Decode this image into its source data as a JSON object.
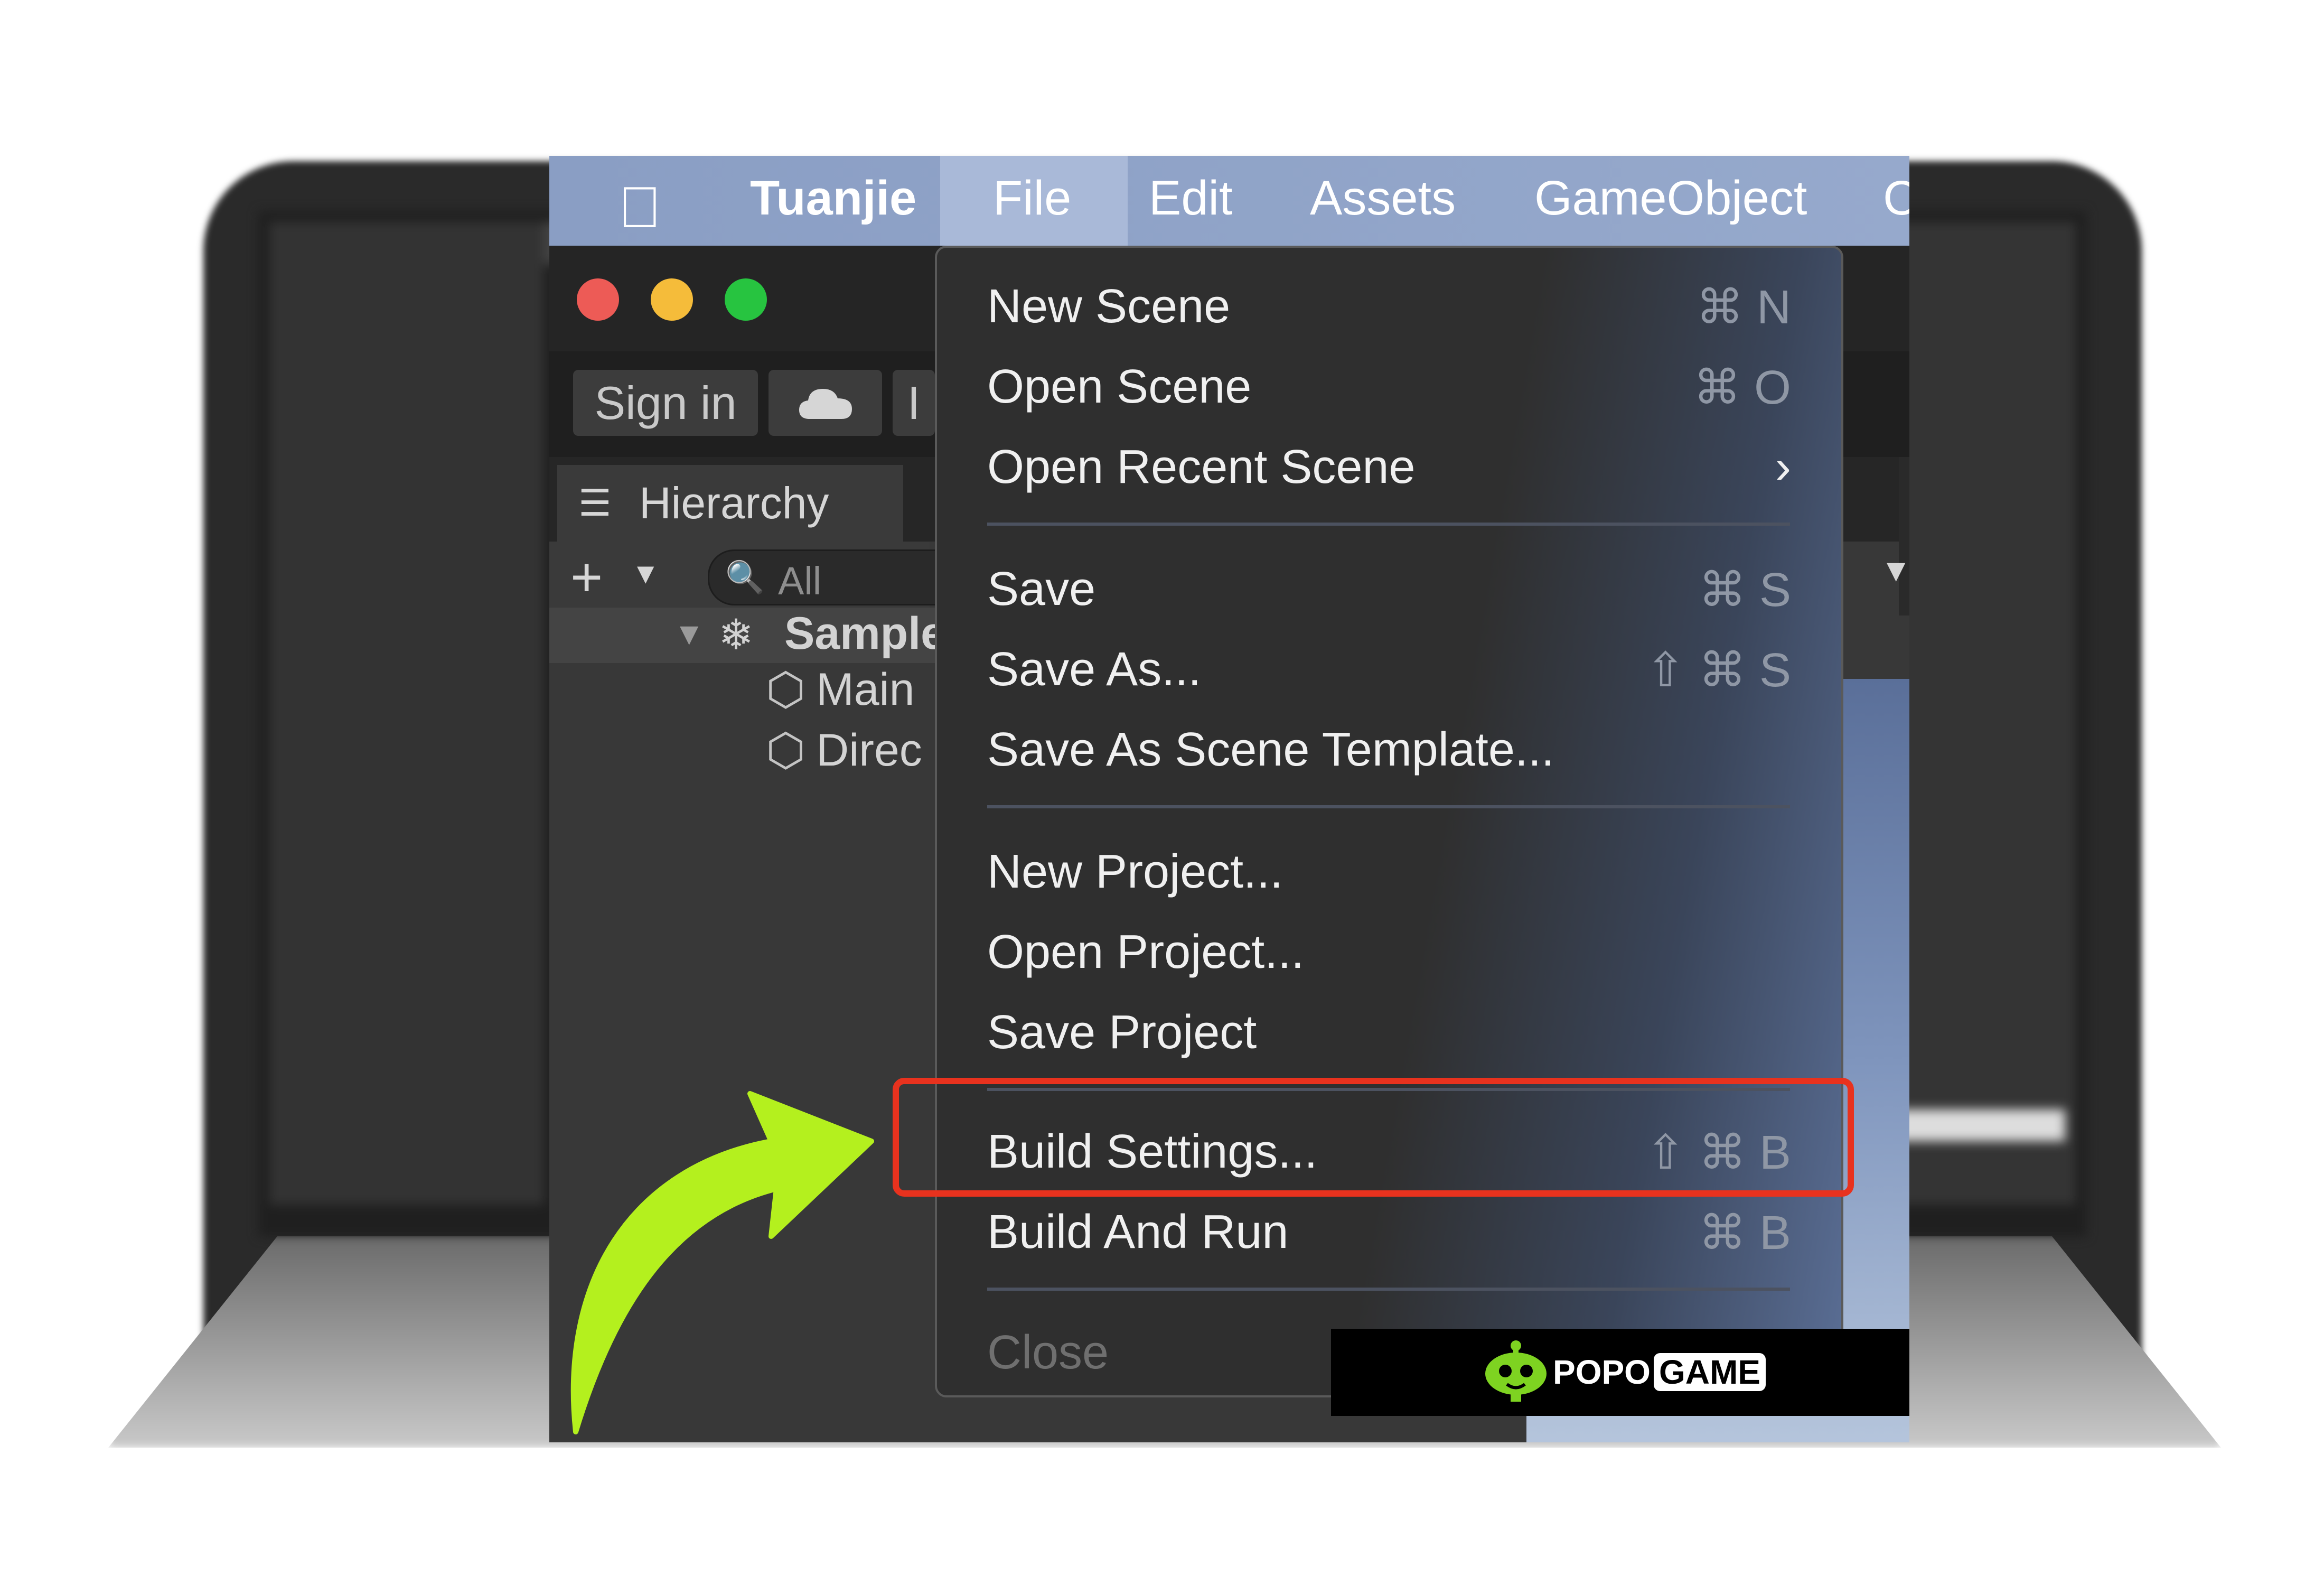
{
  "menubar": {
    "app_name": "Tuanjie",
    "items": [
      "File",
      "Edit",
      "Assets",
      "GameObject",
      "C"
    ]
  },
  "toolbar": {
    "sign_in": "Sign in",
    "more": "I"
  },
  "hierarchy": {
    "tab_label": "Hierarchy",
    "search_placeholder": "All",
    "scene_label": "Sample",
    "objects": [
      "Main",
      "Direc"
    ]
  },
  "file_menu": {
    "items": [
      {
        "label": "New Scene",
        "shortcut": "⌘ N"
      },
      {
        "label": "Open Scene",
        "shortcut": "⌘ O"
      },
      {
        "label": "Open Recent Scene",
        "shortcut": "›"
      },
      {
        "label": "Save",
        "shortcut": "⌘ S"
      },
      {
        "label": "Save As...",
        "shortcut": "⇧ ⌘ S"
      },
      {
        "label": "Save As Scene Template...",
        "shortcut": ""
      },
      {
        "label": "New Project...",
        "shortcut": ""
      },
      {
        "label": "Open Project...",
        "shortcut": ""
      },
      {
        "label": "Save Project",
        "shortcut": ""
      },
      {
        "label": "Build Settings...",
        "shortcut": "⇧ ⌘ B"
      },
      {
        "label": "Build And Run",
        "shortcut": "⌘ B"
      },
      {
        "label": "Close",
        "shortcut": ""
      }
    ]
  },
  "branding": {
    "logo_text": "POPO",
    "logo_text_2": "GAME"
  },
  "colors": {
    "highlight": "#e8321e",
    "arrow": "#b4f01e",
    "menubar": "#8fa3c8"
  }
}
